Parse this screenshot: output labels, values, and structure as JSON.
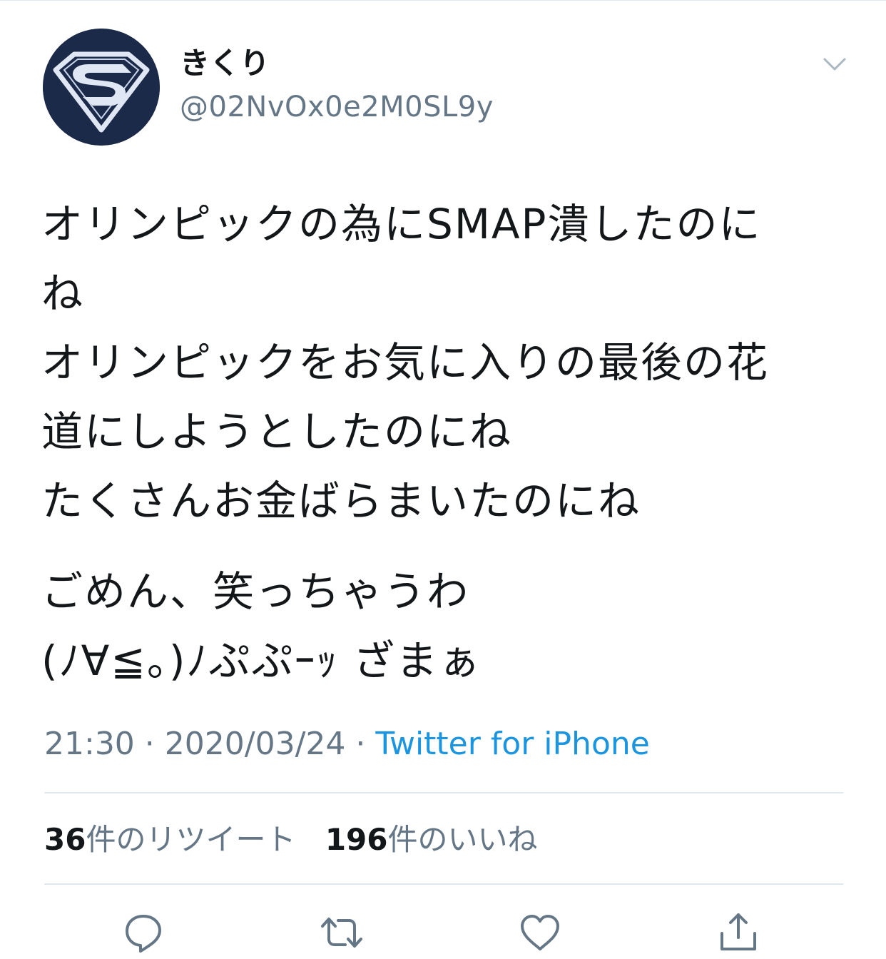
{
  "colors": {
    "text_primary": "#14171a",
    "text_secondary": "#657786",
    "link": "#1b95e0",
    "divider": "#e1e8ed",
    "avatar_bg": "#1c2a4a"
  },
  "author": {
    "display_name": "きくり",
    "handle": "@02NvOx0e2M0SL9y",
    "avatar_icon": "superman-s-shield-icon",
    "more_icon": "chevron-down-icon"
  },
  "tweet": {
    "lines": [
      "オリンピックの為にSMAP潰したのに",
      "ね",
      "オリンピックをお気に入りの最後の花",
      "道にしようとしたのにね",
      "たくさんお金ばらまいたのにね",
      "ごめん、笑っちゃうわ",
      "(ﾉ∀≦。)ﾉぷぷｰｯ ざまぁ"
    ]
  },
  "meta": {
    "time": "21:30",
    "separator": " · ",
    "date": "2020/03/24",
    "source": "Twitter for iPhone"
  },
  "stats": {
    "retweets_count": "36",
    "retweets_label": "件のリツイート",
    "likes_count": "196",
    "likes_label": "件のいいね"
  },
  "actions": [
    {
      "name": "reply",
      "icon": "reply-bubble-icon"
    },
    {
      "name": "retweet",
      "icon": "retweet-arrows-icon"
    },
    {
      "name": "like",
      "icon": "heart-icon"
    },
    {
      "name": "share",
      "icon": "share-upload-icon"
    }
  ]
}
